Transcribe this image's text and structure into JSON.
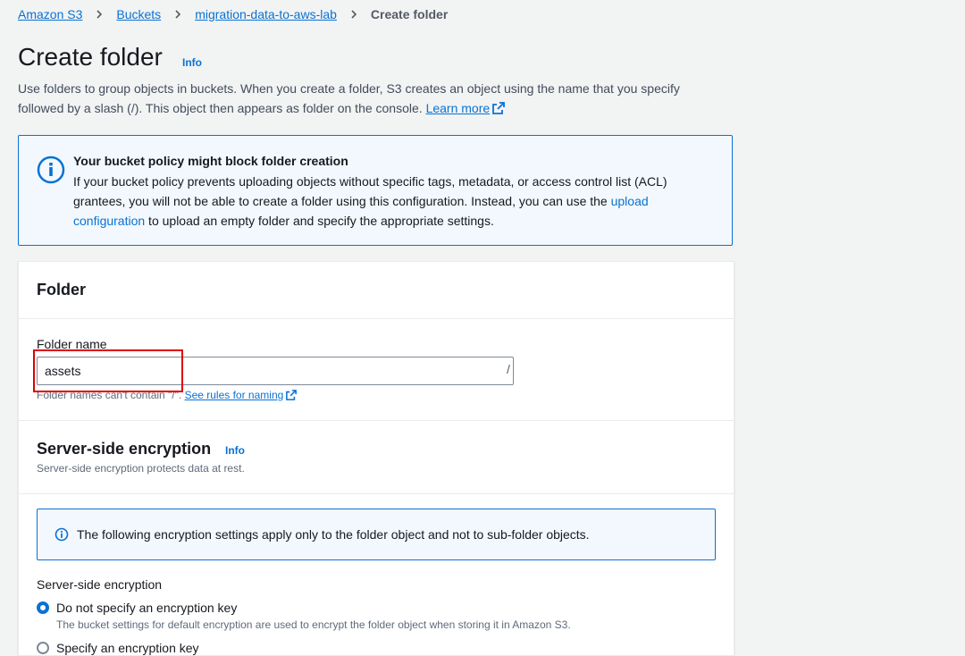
{
  "breadcrumb": {
    "items": [
      "Amazon S3",
      "Buckets",
      "migration-data-to-aws-lab"
    ],
    "current": "Create folder"
  },
  "page": {
    "title": "Create folder",
    "info": "Info",
    "description": "Use folders to group objects in buckets. When you create a folder, S3 creates an object using the name that you specify followed by a slash (/). This object then appears as folder on the console.",
    "learn_more": "Learn more"
  },
  "alert": {
    "title": "Your bucket policy might block folder creation",
    "body_before": "If your bucket policy prevents uploading objects without specific tags, metadata, or access control list (ACL) grantees, you will not be able to create a folder using this configuration. Instead, you can use the ",
    "link": "upload configuration",
    "body_after": " to upload an empty folder and specify the appropriate settings."
  },
  "folder": {
    "heading": "Folder",
    "label": "Folder name",
    "value": "assets",
    "suffix": "/",
    "hint": "Folder names can't contain \"/\". ",
    "hint_link": "See rules for naming"
  },
  "sse": {
    "heading": "Server-side encryption",
    "info": "Info",
    "description": "Server-side encryption protects data at rest.",
    "notice": "The following encryption settings apply only to the folder object and not to sub-folder objects.",
    "field_label": "Server-side encryption",
    "options": [
      {
        "label": "Do not specify an encryption key",
        "description": "The bucket settings for default encryption are used to encrypt the folder object when storing it in Amazon S3.",
        "selected": true
      },
      {
        "label": "Specify an encryption key",
        "selected": false
      }
    ]
  },
  "colors": {
    "link": "#0972d3",
    "highlight": "#e00000",
    "background": "#f2f3f3"
  }
}
